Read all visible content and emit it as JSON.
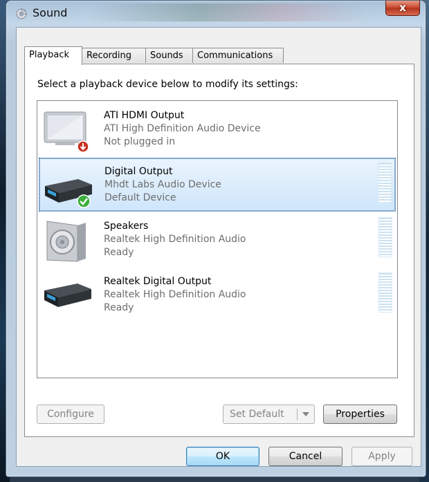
{
  "window": {
    "title": "Sound",
    "close_label": "x"
  },
  "tabs": [
    {
      "label": "Playback",
      "active": true
    },
    {
      "label": "Recording",
      "active": false
    },
    {
      "label": "Sounds",
      "active": false
    },
    {
      "label": "Communications",
      "active": false
    }
  ],
  "instruction": "Select a playback device below to modify its settings:",
  "devices": [
    {
      "name": "ATI HDMI Output",
      "description": "ATI High Definition Audio Device",
      "status": "Not plugged in",
      "icon": "monitor-icon",
      "badge": "unplugged-arrow-icon",
      "selected": false
    },
    {
      "name": "Digital Output",
      "description": "Mhdt Labs Audio Device",
      "status": "Default Device",
      "icon": "digital-receiver-icon",
      "badge": "default-check-icon",
      "selected": true
    },
    {
      "name": "Speakers",
      "description": "Realtek High Definition Audio",
      "status": "Ready",
      "icon": "speaker-icon",
      "selected": false
    },
    {
      "name": "Realtek Digital Output",
      "description": "Realtek High Definition Audio",
      "status": "Ready",
      "icon": "digital-receiver-icon",
      "selected": false
    }
  ],
  "buttons": {
    "configure": "Configure",
    "set_default": "Set Default",
    "properties": "Properties",
    "ok": "OK",
    "cancel": "Cancel",
    "apply": "Apply"
  },
  "colors": {
    "selection": "#cfe6fb",
    "default_check": "#3cae3c",
    "unplugged_badge": "#c83220"
  }
}
